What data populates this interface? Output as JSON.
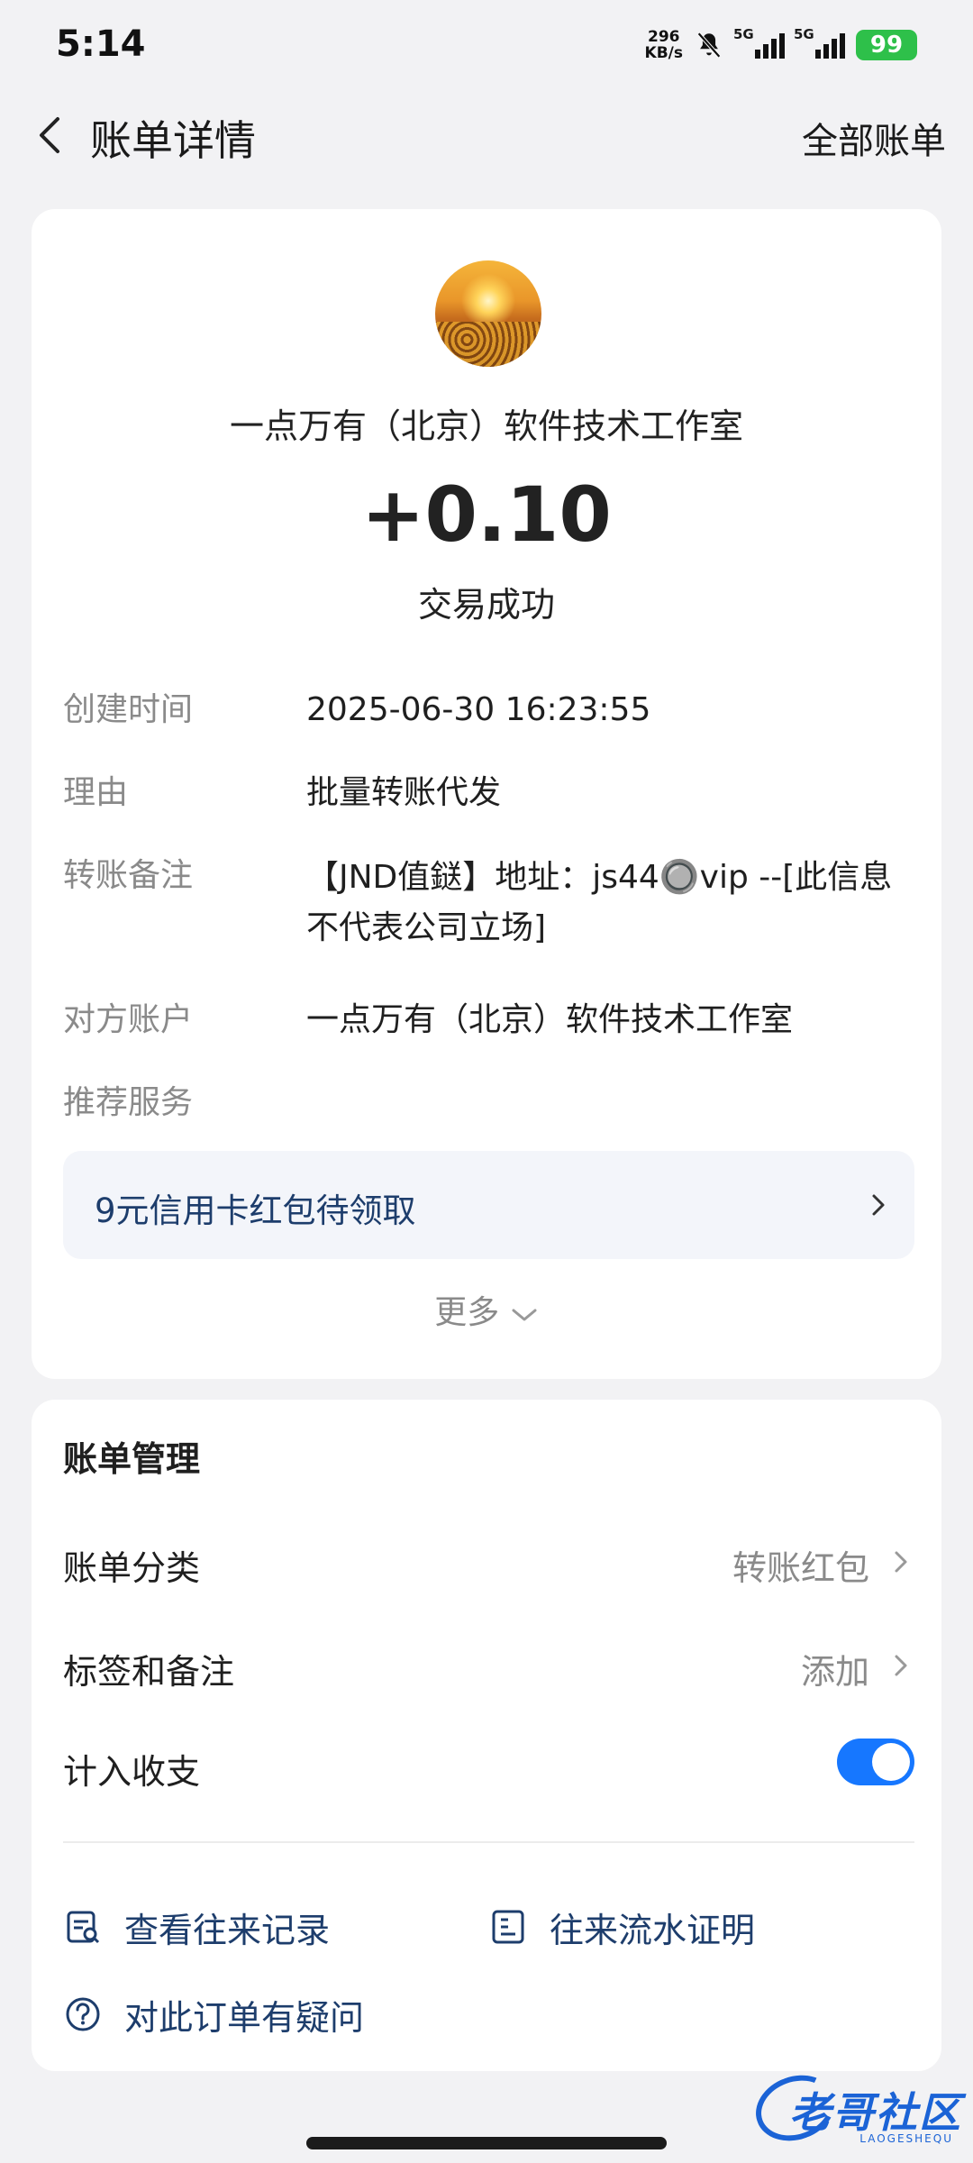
{
  "status_bar": {
    "time": "5:14",
    "net_speed": "296",
    "net_unit": "KB/s",
    "signal1_label": "5G",
    "signal2_label": "5G",
    "battery": "99"
  },
  "nav": {
    "title": "账单详情",
    "right_link": "全部账单"
  },
  "transaction": {
    "payee": "一点万有（北京）软件技术工作室",
    "amount": "+0.10",
    "status": "交易成功"
  },
  "details": [
    {
      "label": "创建时间",
      "value": "2025-06-30 16:23:55"
    },
    {
      "label": "理由",
      "value": "批量转账代发"
    },
    {
      "label": "转账备注",
      "value": "【JND值鎹】地址：js44🔘vip --[此信息不代表公司立场]"
    },
    {
      "label": "对方账户",
      "value": "一点万有（北京）软件技术工作室"
    },
    {
      "label": "推荐服务",
      "value": ""
    }
  ],
  "promo": {
    "text": "9元信用卡红包待领取"
  },
  "more": {
    "label": "更多"
  },
  "management": {
    "title": "账单管理",
    "category_label": "账单分类",
    "category_value": "转账红包",
    "tags_label": "标签和备注",
    "tags_value": "添加",
    "count_label": "计入收支",
    "count_enabled": true
  },
  "links": {
    "records": "查看往来记录",
    "statement": "往来流水证明",
    "question": "对此订单有疑问"
  },
  "colors": {
    "accent": "#1677ff",
    "link_text": "#1d3d6c",
    "battery": "#2ec04a"
  },
  "watermark": {
    "text": "老哥社区",
    "sub": "LAOGESHEQU"
  }
}
